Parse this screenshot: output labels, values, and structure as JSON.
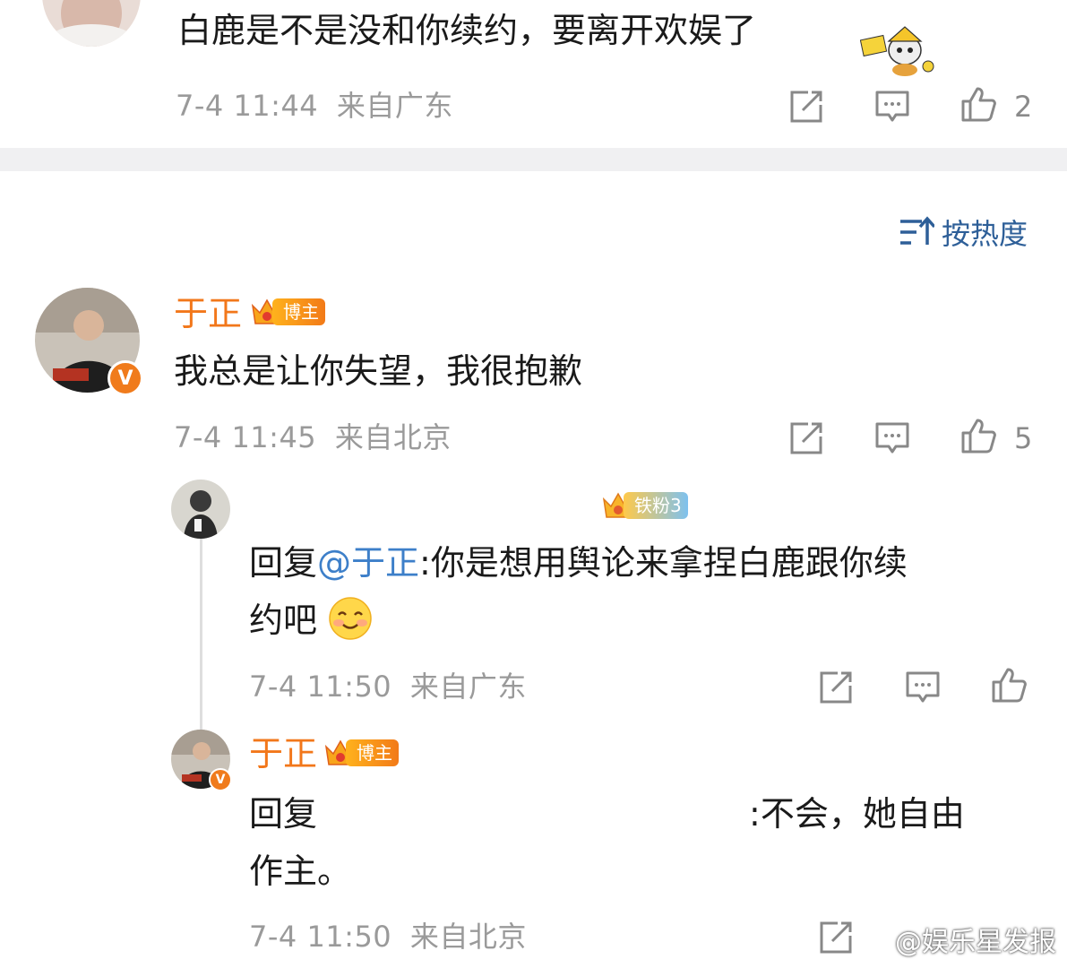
{
  "comments": [
    {
      "text": "白鹿是不是没和你续约，要离开欢娱了",
      "time": "7-4 11:44",
      "location": "来自广东",
      "likes": "2"
    },
    {
      "username": "于正",
      "badge": "博主",
      "text": "我总是让你失望，我很抱歉",
      "time": "7-4 11:45",
      "location": "来自北京",
      "likes": "5",
      "replies": [
        {
          "badge": "铁粉3",
          "reply_prefix": "回复",
          "mention": "@于正",
          "text_line1": ":你是想用舆论来拿捏白鹿跟你续",
          "text_line2": "约吧",
          "time": "7-4 11:50",
          "location": "来自广东"
        },
        {
          "username": "于正",
          "badge": "博主",
          "reply_prefix": "回复",
          "text_tail": ":不会，她自由",
          "text_line2": "作主。",
          "time": "7-4 11:50",
          "location": "来自北京"
        }
      ]
    }
  ],
  "sort": {
    "label": "按热度"
  },
  "watermark": {
    "text": "@娱乐星发报"
  },
  "icons": {
    "share": "share-icon",
    "comment": "comment-icon",
    "like": "thumbs-up-icon",
    "sort": "sort-icon",
    "verified": "v",
    "emoji": "smile-emoji-icon"
  },
  "colors": {
    "username": "#f2771a",
    "mention": "#3d7fc9",
    "sort": "#2e5f98",
    "meta": "#9a9a9a"
  }
}
